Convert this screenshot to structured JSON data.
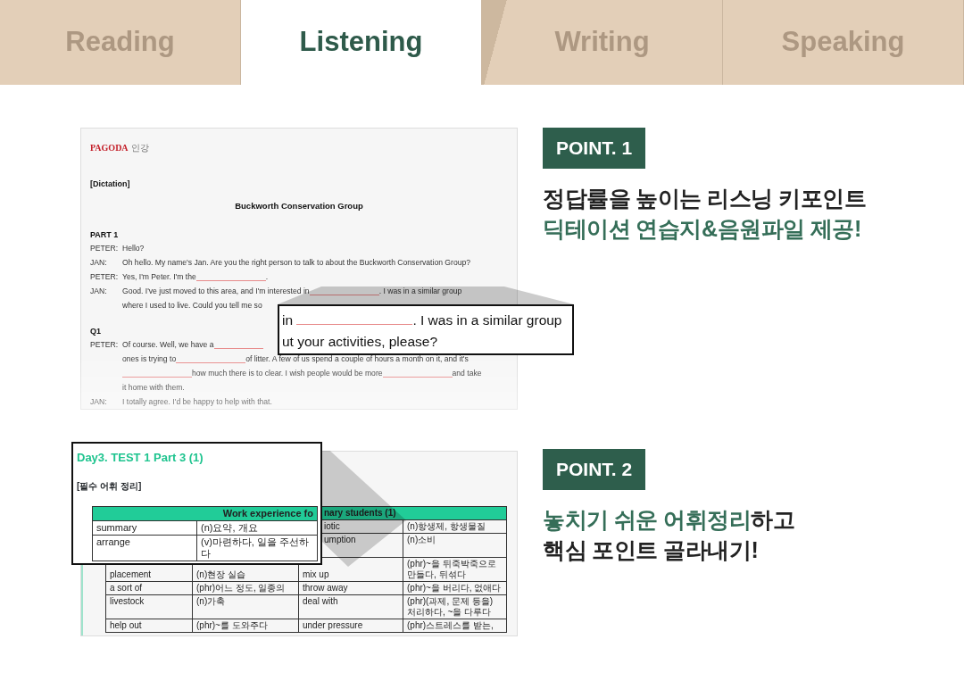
{
  "tabs": [
    {
      "label": "Reading",
      "selected": false
    },
    {
      "label": "Listening",
      "selected": true
    },
    {
      "label": "Writing",
      "selected": false
    },
    {
      "label": "Speaking",
      "selected": false
    }
  ],
  "sections": [
    {
      "kind": "dictation",
      "badge": "POINT. 1",
      "headline": [
        {
          "segments": [
            {
              "text": "정답률을 높이는 리스닝 키포인트",
              "highlight": false
            }
          ]
        },
        {
          "segments": [
            {
              "text": "딕테이션 연습지&음원파일 제공!",
              "highlight": true
            }
          ]
        }
      ],
      "document": {
        "logo": "PAGODA",
        "logo_suffix": "인강",
        "label": "[Dictation]",
        "title": "Buckworth Conservation Group",
        "blocks": [
          {
            "heading": "PART 1",
            "lines": [
              {
                "speaker": "PETER:",
                "parts": [
                  {
                    "kind": "text",
                    "text": "Hello?"
                  }
                ]
              },
              {
                "speaker": "JAN:",
                "parts": [
                  {
                    "kind": "text",
                    "text": "Oh hello. My name's Jan. Are you the right person to talk to about the Buckworth Conservation Group?"
                  }
                ]
              },
              {
                "speaker": "PETER:",
                "parts": [
                  {
                    "kind": "text",
                    "text": "Yes, I'm Peter. I'm the "
                  },
                  {
                    "kind": "blank"
                  },
                  {
                    "kind": "text",
                    "text": "."
                  }
                ]
              },
              {
                "speaker": "JAN:",
                "parts": [
                  {
                    "kind": "text",
                    "text": "Good. I've just moved to this area, and I'm interested in "
                  },
                  {
                    "kind": "blank"
                  },
                  {
                    "kind": "text",
                    "text": ". I was in a similar group"
                  }
                ]
              },
              {
                "parts": [
                  {
                    "kind": "text",
                    "text": "where I used to live. Could you tell me so"
                  }
                ]
              }
            ]
          },
          {
            "heading": "Q1",
            "lines": [
              {
                "speaker": "PETER:",
                "parts": [
                  {
                    "kind": "text",
                    "text": "Of course. Well, we have a "
                  },
                  {
                    "kind": "blank"
                  }
                ]
              },
              {
                "parts": [
                  {
                    "kind": "text",
                    "text": "ones is trying to "
                  },
                  {
                    "kind": "blank"
                  },
                  {
                    "kind": "text",
                    "text": " of litter. A few of us spend a couple of hours a month on it, and it's"
                  }
                ]
              },
              {
                "parts": [
                  {
                    "kind": "blank"
                  },
                  {
                    "kind": "text",
                    "text": " how much there is to clear. I wish people would be more "
                  },
                  {
                    "kind": "blank"
                  },
                  {
                    "kind": "text",
                    "text": " and take"
                  }
                ]
              },
              {
                "parts": [
                  {
                    "kind": "text",
                    "text": "it home with them."
                  }
                ]
              },
              {
                "speaker": "JAN:",
                "parts": [
                  {
                    "kind": "text",
                    "text": "I totally agree. I'd be happy to help with that."
                  }
                ]
              }
            ]
          }
        ]
      },
      "magnifier": {
        "lines": [
          {
            "parts": [
              {
                "kind": "text",
                "text": "in "
              },
              {
                "kind": "blank"
              },
              {
                "kind": "text",
                "text": ". I was in a similar group"
              }
            ]
          },
          {
            "parts": [
              {
                "kind": "text",
                "text": "ut your activities, please?"
              }
            ]
          }
        ]
      }
    },
    {
      "kind": "vocabulary",
      "badge": "POINT. 2",
      "headline": [
        {
          "segments": [
            {
              "text": "놓치기 쉬운 어휘정리",
              "highlight": true
            },
            {
              "text": "하고",
              "highlight": false
            }
          ]
        },
        {
          "segments": [
            {
              "text": "핵심 포인트 골라내기!",
              "highlight": false
            }
          ]
        }
      ],
      "document": {
        "header": "nary students (1)",
        "rows": [
          [
            null,
            null,
            "iotic",
            "(n)항생제, 항생물질"
          ],
          [
            null,
            null,
            "umption",
            "(n)소비"
          ],
          [
            "placement",
            "(n)현장 실습",
            "mix up",
            "(phr)~을 뒤죽박죽으로 만들다, 뒤섞다"
          ],
          [
            "a sort of",
            "(phr)어느 정도, 일종의",
            "throw away",
            "(phr)~을 버리다, 없애다"
          ],
          [
            "livestock",
            "(n)가축",
            "deal with",
            "(phr)(과제, 문제 등을) 처리하다, ~을 다루다"
          ],
          [
            "help out",
            "(phr)~를 도와주다",
            "under pressure",
            "(phr)스트레스를 받는,"
          ]
        ]
      },
      "magnifier": {
        "title": "Day3. TEST 1 Part 3 (1)",
        "subtitle": "[필수 어휘 정리]",
        "header": "Work experience fo",
        "rows": [
          [
            "summary",
            "(n)요약, 개요"
          ],
          [
            "arrange",
            "(v)마련하다, 일을 주선하다"
          ]
        ]
      }
    }
  ]
}
